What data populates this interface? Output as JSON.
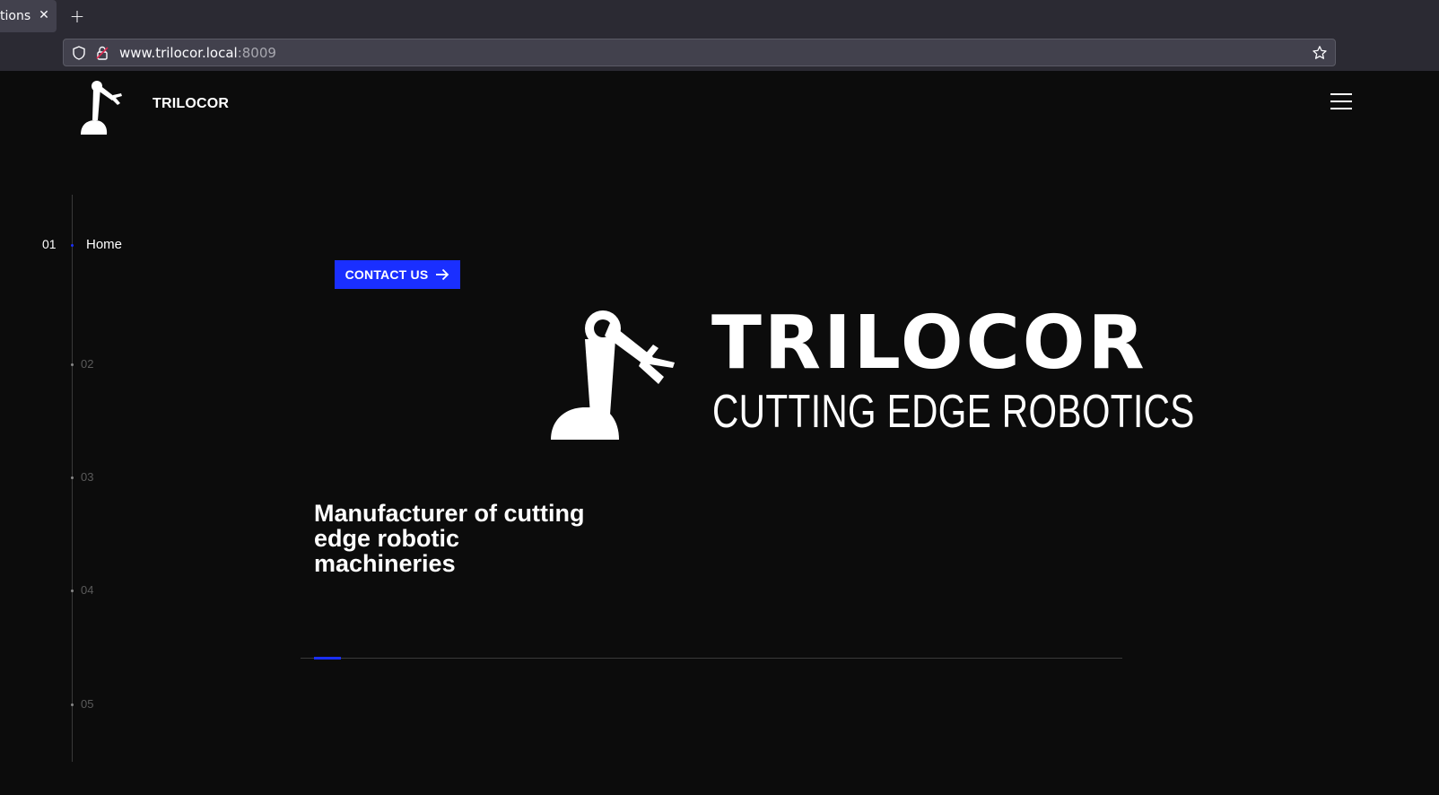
{
  "browser": {
    "tab_title": "tions",
    "close_glyph": "✕",
    "new_tab_glyph": "+",
    "url_host": "www.trilocor.local",
    "url_port": ":8009"
  },
  "site": {
    "name": "TRILOCOR",
    "menu_icon": "hamburger-menu-icon"
  },
  "side_nav": {
    "active": {
      "number": "01",
      "label": "Home"
    },
    "items": [
      {
        "number": "02"
      },
      {
        "number": "03"
      },
      {
        "number": "04"
      },
      {
        "number": "05"
      }
    ]
  },
  "hero": {
    "cta_label": "CONTACT US",
    "brand_title": "TRILOCOR",
    "brand_subtitle": "CUTTING EDGE ROBOTICS",
    "tagline": "Manufacturer of cutting edge robotic machineries",
    "slide_progress": 0.03
  },
  "colors": {
    "accent": "#1a2fff",
    "background": "#0c0c0c",
    "chrome": "#2b2a33",
    "urlbar": "#42414d"
  }
}
